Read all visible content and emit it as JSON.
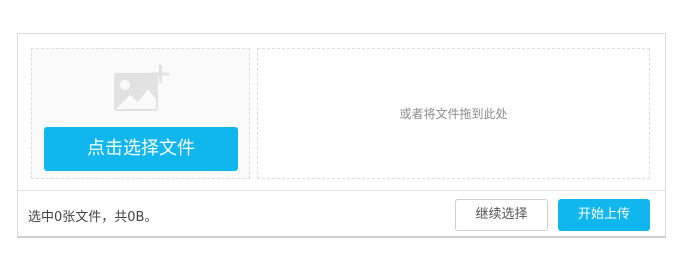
{
  "uploader": {
    "pick_button_label": "点击选择文件",
    "drop_hint": "或者将文件拖到此处",
    "status": "选中0张文件，共0B。",
    "continue_label": "继续选择",
    "start_label": "开始上传",
    "icons": {
      "placeholder": "image-add-icon"
    }
  },
  "colors": {
    "accent": "#10b7ee",
    "border": "#dadada",
    "dashed_border": "#dcdcdc",
    "icon_gray": "#dddddd"
  }
}
